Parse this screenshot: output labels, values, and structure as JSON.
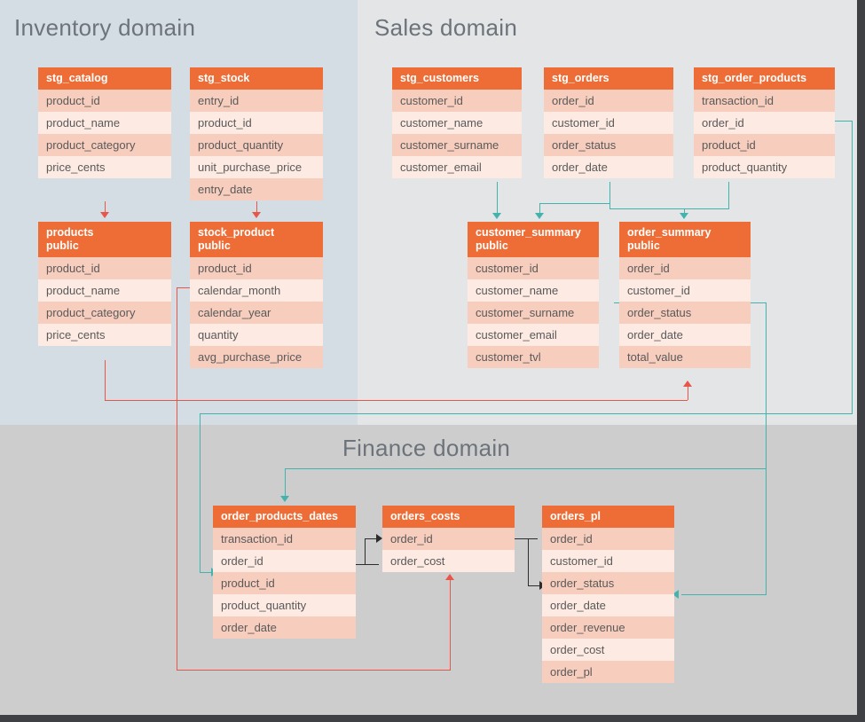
{
  "domains": [
    {
      "key": "inventory",
      "title": "Inventory domain",
      "bg": "#d5dde4"
    },
    {
      "key": "sales",
      "title": "Sales domain",
      "bg": "#e3e5e6"
    },
    {
      "key": "finance",
      "title": "Finance domain",
      "bg": "#cdcdcd"
    }
  ],
  "colors": {
    "header_orange": "#ee6d36",
    "row_dark": "#f7cdbd",
    "row_light": "#fdeae2",
    "connector_red": "#e8564a",
    "connector_teal": "#44b3ae",
    "connector_dark": "#2c2c2c",
    "title_gray": "#6d737a",
    "field_text": "#5a5a5a"
  },
  "tables": {
    "stg_catalog": {
      "name": "stg_catalog",
      "schema": "",
      "domain": "inventory",
      "fields": [
        "product_id",
        "product_name",
        "product_category",
        "price_cents"
      ]
    },
    "stg_stock": {
      "name": "stg_stock",
      "schema": "",
      "domain": "inventory",
      "fields": [
        "entry_id",
        "product_id",
        "product_quantity",
        "unit_purchase_price",
        "entry_date"
      ]
    },
    "products": {
      "name": "products",
      "schema": "public",
      "domain": "inventory",
      "fields": [
        "product_id",
        "product_name",
        "product_category",
        "price_cents"
      ]
    },
    "stock_product": {
      "name": "stock_product",
      "schema": "public",
      "domain": "inventory",
      "fields": [
        "product_id",
        "calendar_month",
        "calendar_year",
        "quantity",
        "avg_purchase_price"
      ]
    },
    "stg_customers": {
      "name": "stg_customers",
      "schema": "",
      "domain": "sales",
      "fields": [
        "customer_id",
        "customer_name",
        "customer_surname",
        "customer_email"
      ]
    },
    "stg_orders": {
      "name": "stg_orders",
      "schema": "",
      "domain": "sales",
      "fields": [
        "order_id",
        "customer_id",
        "order_status",
        "order_date"
      ]
    },
    "stg_order_products": {
      "name": "stg_order_products",
      "schema": "",
      "domain": "sales",
      "fields": [
        "transaction_id",
        "order_id",
        "product_id",
        "product_quantity"
      ]
    },
    "customer_summary": {
      "name": "customer_summary",
      "schema": "public",
      "domain": "sales",
      "fields": [
        "customer_id",
        "customer_name",
        "customer_surname",
        "customer_email",
        "customer_tvl"
      ]
    },
    "order_summary": {
      "name": "order_summary",
      "schema": "public",
      "domain": "sales",
      "fields": [
        "order_id",
        "customer_id",
        "order_status",
        "order_date",
        "total_value"
      ]
    },
    "order_products_dates": {
      "name": "order_products_dates",
      "schema": "",
      "domain": "finance",
      "fields": [
        "transaction_id",
        "order_id",
        "product_id",
        "product_quantity",
        "order_date"
      ]
    },
    "orders_costs": {
      "name": "orders_costs",
      "schema": "",
      "domain": "finance",
      "fields": [
        "order_id",
        "order_cost"
      ]
    },
    "orders_pl": {
      "name": "orders_pl",
      "schema": "",
      "domain": "finance",
      "fields": [
        "order_id",
        "customer_id",
        "order_status",
        "order_date",
        "order_revenue",
        "order_cost",
        "order_pl"
      ]
    }
  }
}
